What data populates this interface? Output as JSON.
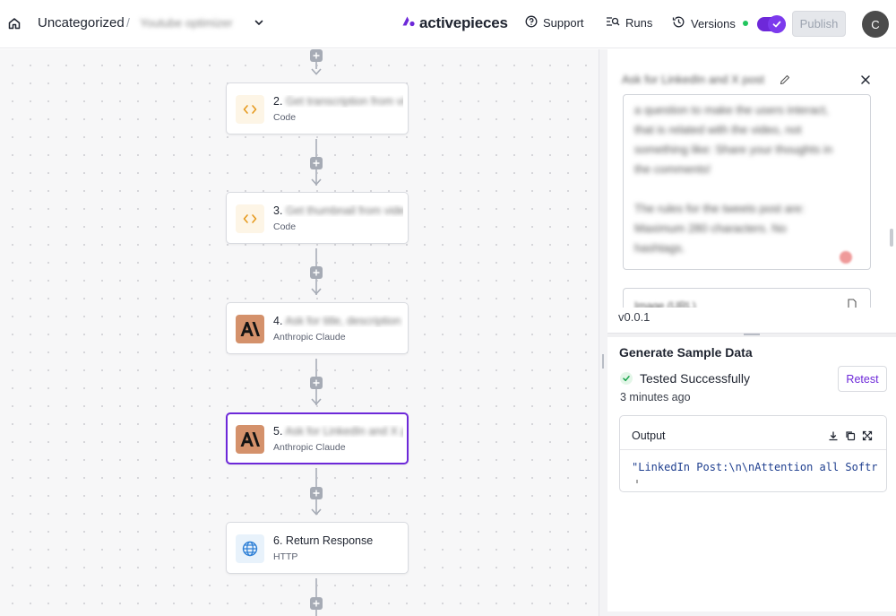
{
  "header": {
    "breadcrumb_root": "Uncategorized",
    "breadcrumb_sep": "/",
    "flow_name": "Youtube optimizer",
    "logo_text": "activepieces",
    "support_label": "Support",
    "runs_label": "Runs",
    "versions_label": "Versions",
    "publish_label": "Publish",
    "avatar_initial": "C"
  },
  "flow": {
    "nodes": [
      {
        "number": "2.",
        "name": "Get transcription from video",
        "type": "Code",
        "icon": "code-icon"
      },
      {
        "number": "3.",
        "name": "Get thumbnail from video",
        "type": "Code",
        "icon": "code-icon"
      },
      {
        "number": "4.",
        "name": "Ask for title, description",
        "type": "Anthropic Claude",
        "icon": "anthropic-icon"
      },
      {
        "number": "5.",
        "name": "Ask for LinkedIn and X post",
        "type": "Anthropic Claude",
        "icon": "anthropic-icon"
      },
      {
        "number": "6.",
        "name": "Return Response",
        "type": "HTTP",
        "icon": "globe-icon"
      }
    ]
  },
  "panel": {
    "step_title": "Ask for LinkedIn and X post",
    "prompt_text": "a question to make the users interact,\nthat is related with the video, not\nsomething like: Share your thoughts in\nthe comments!\n\nThe rules for the tweets post are:\nMaximum 280 characters. No\nhashtags.",
    "image_field_label": "Image (URL)",
    "version": "v0.0.1",
    "sample_title": "Generate Sample Data",
    "status": "Tested Successfully",
    "time_ago": "3 minutes ago",
    "retest_label": "Retest",
    "output_label": "Output",
    "output_value": "\"LinkedIn Post:\\n\\nAttention all Softr"
  },
  "colors": {
    "accent": "#6d28d9",
    "success": "#22c55e"
  }
}
